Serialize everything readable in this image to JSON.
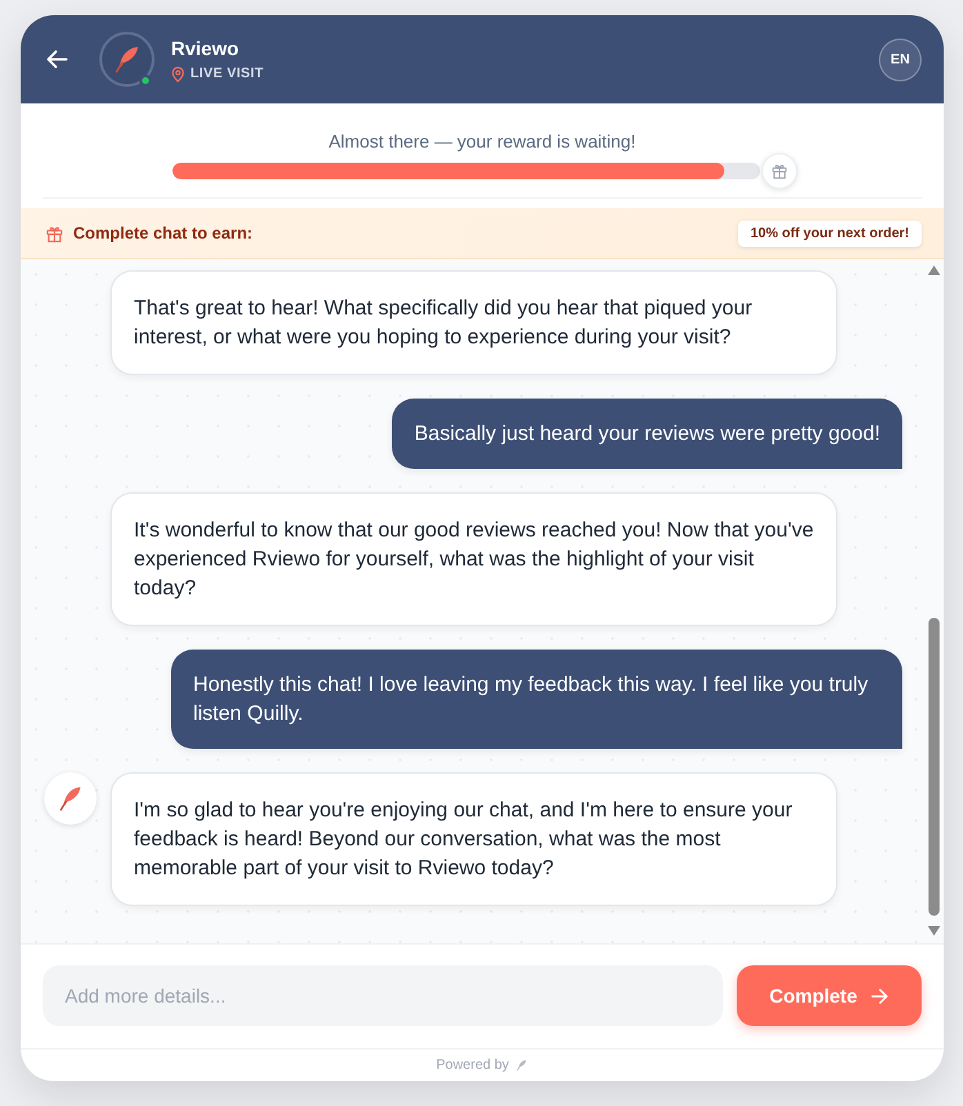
{
  "header": {
    "title": "Rviewo",
    "subtitle": "LIVE VISIT",
    "online": true,
    "language": "EN"
  },
  "progress": {
    "caption": "Almost there — your reward is waiting!",
    "level": 0.94
  },
  "reward": {
    "label": "Complete chat to earn:",
    "badge": "10% off your next order!"
  },
  "messages": [
    {
      "kind": "bot",
      "avatar": false,
      "text": "That's great to hear! What specifically did you hear that piqued your interest, or what were you hoping to experience during your visit?"
    },
    {
      "kind": "user",
      "text": "Basically just heard your reviews were pretty good!"
    },
    {
      "kind": "bot",
      "avatar": false,
      "text": "It's wonderful to know that our good reviews reached you! Now that you've experienced Rviewo for yourself, what was the highlight of your visit today?"
    },
    {
      "kind": "user",
      "text": "Honestly this chat! I love leaving my feedback this way. I feel like you truly listen Quilly."
    },
    {
      "kind": "bot",
      "avatar": true,
      "text": "I'm so glad to hear you're enjoying our chat, and I'm here to ensure your feedback is heard! Beyond our conversation, what was the most memorable part of your visit to Rviewo today?"
    }
  ],
  "composer": {
    "placeholder": "Add more details...",
    "button": "Complete"
  },
  "footer": {
    "text": "Powered by"
  }
}
